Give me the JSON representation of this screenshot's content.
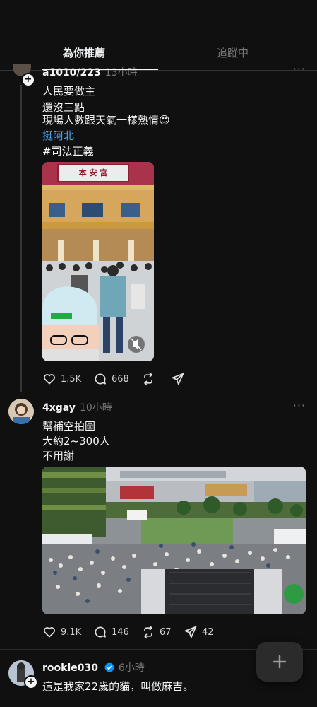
{
  "tabs": {
    "for_you": "為你推薦",
    "following": "追蹤中"
  },
  "posts": [
    {
      "username": "a1010/223",
      "time": "13小時",
      "lines": [
        "人民要做主",
        "還沒三點",
        "現場人數跟天氣一樣熱情😍",
        "挺阿北",
        "#司法正義"
      ],
      "sign_text": "本 安 宮",
      "likes": "1.5K",
      "comments": "668"
    },
    {
      "username": "4xgay",
      "time": "10小時",
      "lines": [
        "幫補空拍圖",
        "大約2~300人",
        "不用謝"
      ],
      "likes": "9.1K",
      "comments": "146",
      "reposts": "67",
      "shares": "42"
    },
    {
      "username": "rookie030",
      "time": "6小時",
      "verified": true,
      "lines": [
        "這是我家22歲的貓，叫做麻吉。"
      ]
    }
  ],
  "colors": {
    "background": "#101010",
    "link": "#4aa3f0",
    "verified": "#0095f6",
    "muted": "#777777"
  }
}
